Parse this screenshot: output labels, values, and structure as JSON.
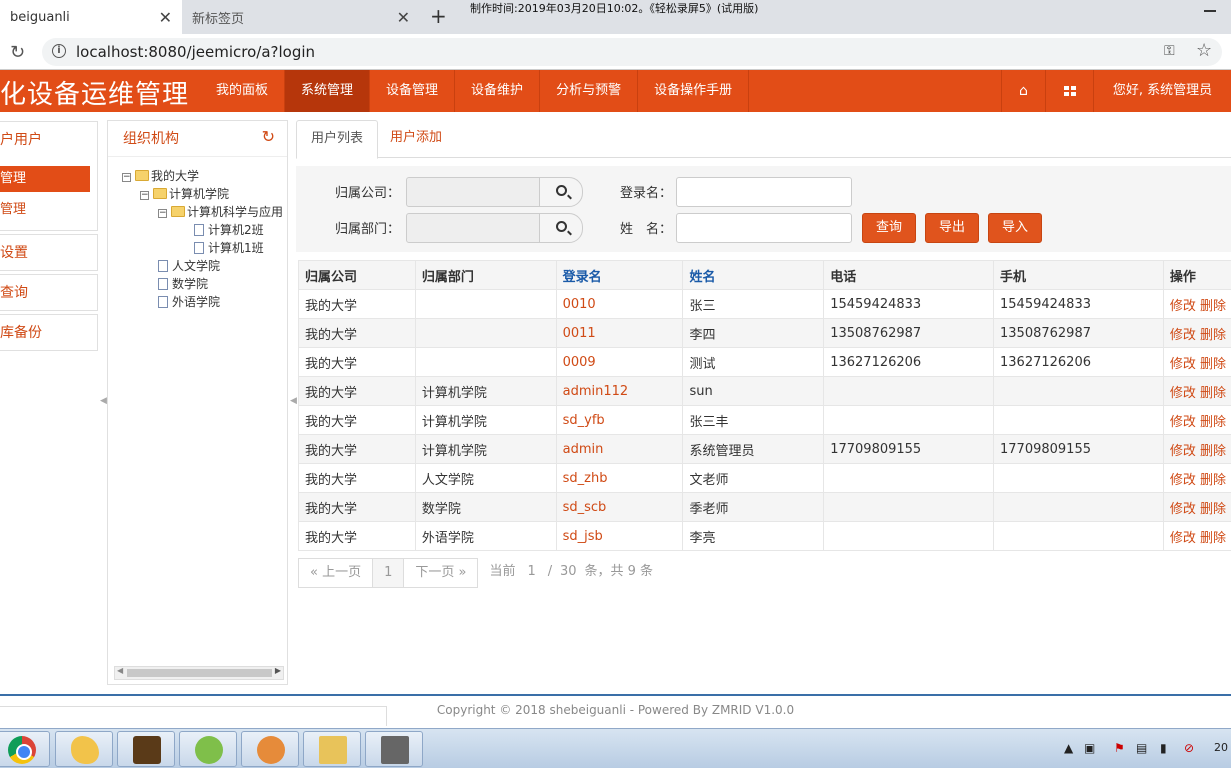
{
  "browser": {
    "tabs": [
      {
        "title": "beiguanli",
        "active": true
      },
      {
        "title": "新标签页",
        "active": false
      }
    ],
    "url": "localhost:8080/jeemicro/a?login",
    "overlay_text": "制作时间:2019年03月20日10:02。《轻松录屏5》(试用版)"
  },
  "header": {
    "title": "化设备运维管理",
    "nav": [
      "我的面板",
      "系统管理",
      "设备管理",
      "设备维护",
      "分析与预警",
      "设备操作手册"
    ],
    "active_nav": "系统管理",
    "greeting": "您好, 系统管理员"
  },
  "left_menu": {
    "groups": [
      {
        "label": "户用户",
        "items": [
          "管理",
          "管理"
        ],
        "active_index": 0
      },
      {
        "label": "设置",
        "items": []
      },
      {
        "label": "查询",
        "items": []
      },
      {
        "label": "库备份",
        "items": []
      }
    ]
  },
  "tree": {
    "title": "组织机构",
    "nodes": [
      {
        "label": "我的大学",
        "level": 0,
        "type": "folder",
        "toggle": "⊟"
      },
      {
        "label": "计算机学院",
        "level": 1,
        "type": "folder",
        "toggle": "⊟"
      },
      {
        "label": "计算机科学与应用",
        "level": 2,
        "type": "folder",
        "toggle": "⊟"
      },
      {
        "label": "计算机2班",
        "level": 3,
        "type": "doc",
        "toggle": ""
      },
      {
        "label": "计算机1班",
        "level": 3,
        "type": "doc",
        "toggle": ""
      },
      {
        "label": "人文学院",
        "level": 1,
        "type": "doc",
        "toggle": ""
      },
      {
        "label": "数学院",
        "level": 1,
        "type": "doc",
        "toggle": ""
      },
      {
        "label": "外语学院",
        "level": 1,
        "type": "doc",
        "toggle": ""
      }
    ]
  },
  "content": {
    "tabs": [
      "用户列表",
      "用户添加"
    ],
    "form": {
      "company_label": "归属公司：",
      "department_label": "归属部门：",
      "login_label": "登录名：",
      "name_label": "姓　名：",
      "company_value": "",
      "department_value": "",
      "login_value": "",
      "name_value": "",
      "buttons": {
        "query": "查询",
        "export": "导出",
        "import": "导入"
      }
    },
    "table": {
      "headers": [
        "归属公司",
        "归属部门",
        "登录名",
        "姓名",
        "电话",
        "手机",
        "操作"
      ],
      "rows": [
        {
          "company": "我的大学",
          "dept": "",
          "login": "0010",
          "name": "张三",
          "phone": "15459424833",
          "mobile": "15459424833"
        },
        {
          "company": "我的大学",
          "dept": "",
          "login": "0011",
          "name": "李四",
          "phone": "13508762987",
          "mobile": "13508762987"
        },
        {
          "company": "我的大学",
          "dept": "",
          "login": "0009",
          "name": "测试",
          "phone": "13627126206",
          "mobile": "13627126206"
        },
        {
          "company": "我的大学",
          "dept": "计算机学院",
          "login": "admin112",
          "name": "sun",
          "phone": "",
          "mobile": ""
        },
        {
          "company": "我的大学",
          "dept": "计算机学院",
          "login": "sd_yfb",
          "name": "张三丰",
          "phone": "",
          "mobile": ""
        },
        {
          "company": "我的大学",
          "dept": "计算机学院",
          "login": "admin",
          "name": "系统管理员",
          "phone": "17709809155",
          "mobile": "17709809155"
        },
        {
          "company": "我的大学",
          "dept": "人文学院",
          "login": "sd_zhb",
          "name": "文老师",
          "phone": "",
          "mobile": ""
        },
        {
          "company": "我的大学",
          "dept": "数学院",
          "login": "sd_scb",
          "name": "季老师",
          "phone": "",
          "mobile": ""
        },
        {
          "company": "我的大学",
          "dept": "外语学院",
          "login": "sd_jsb",
          "name": "李亮",
          "phone": "",
          "mobile": ""
        }
      ],
      "edit_label": "修改",
      "delete_label": "删除"
    },
    "pager": {
      "prev": "« 上一页",
      "current": "1",
      "next": "下一页 »",
      "label_current": "当前",
      "page_input": "1",
      "slash": "/",
      "page_size": "30",
      "summary": "条，共 9 条"
    }
  },
  "footer": {
    "copyright": "Copyright © 2018 shebeiguanli - Powered By ZMRID V1.0.0"
  },
  "taskbar": {
    "clock": "20"
  }
}
